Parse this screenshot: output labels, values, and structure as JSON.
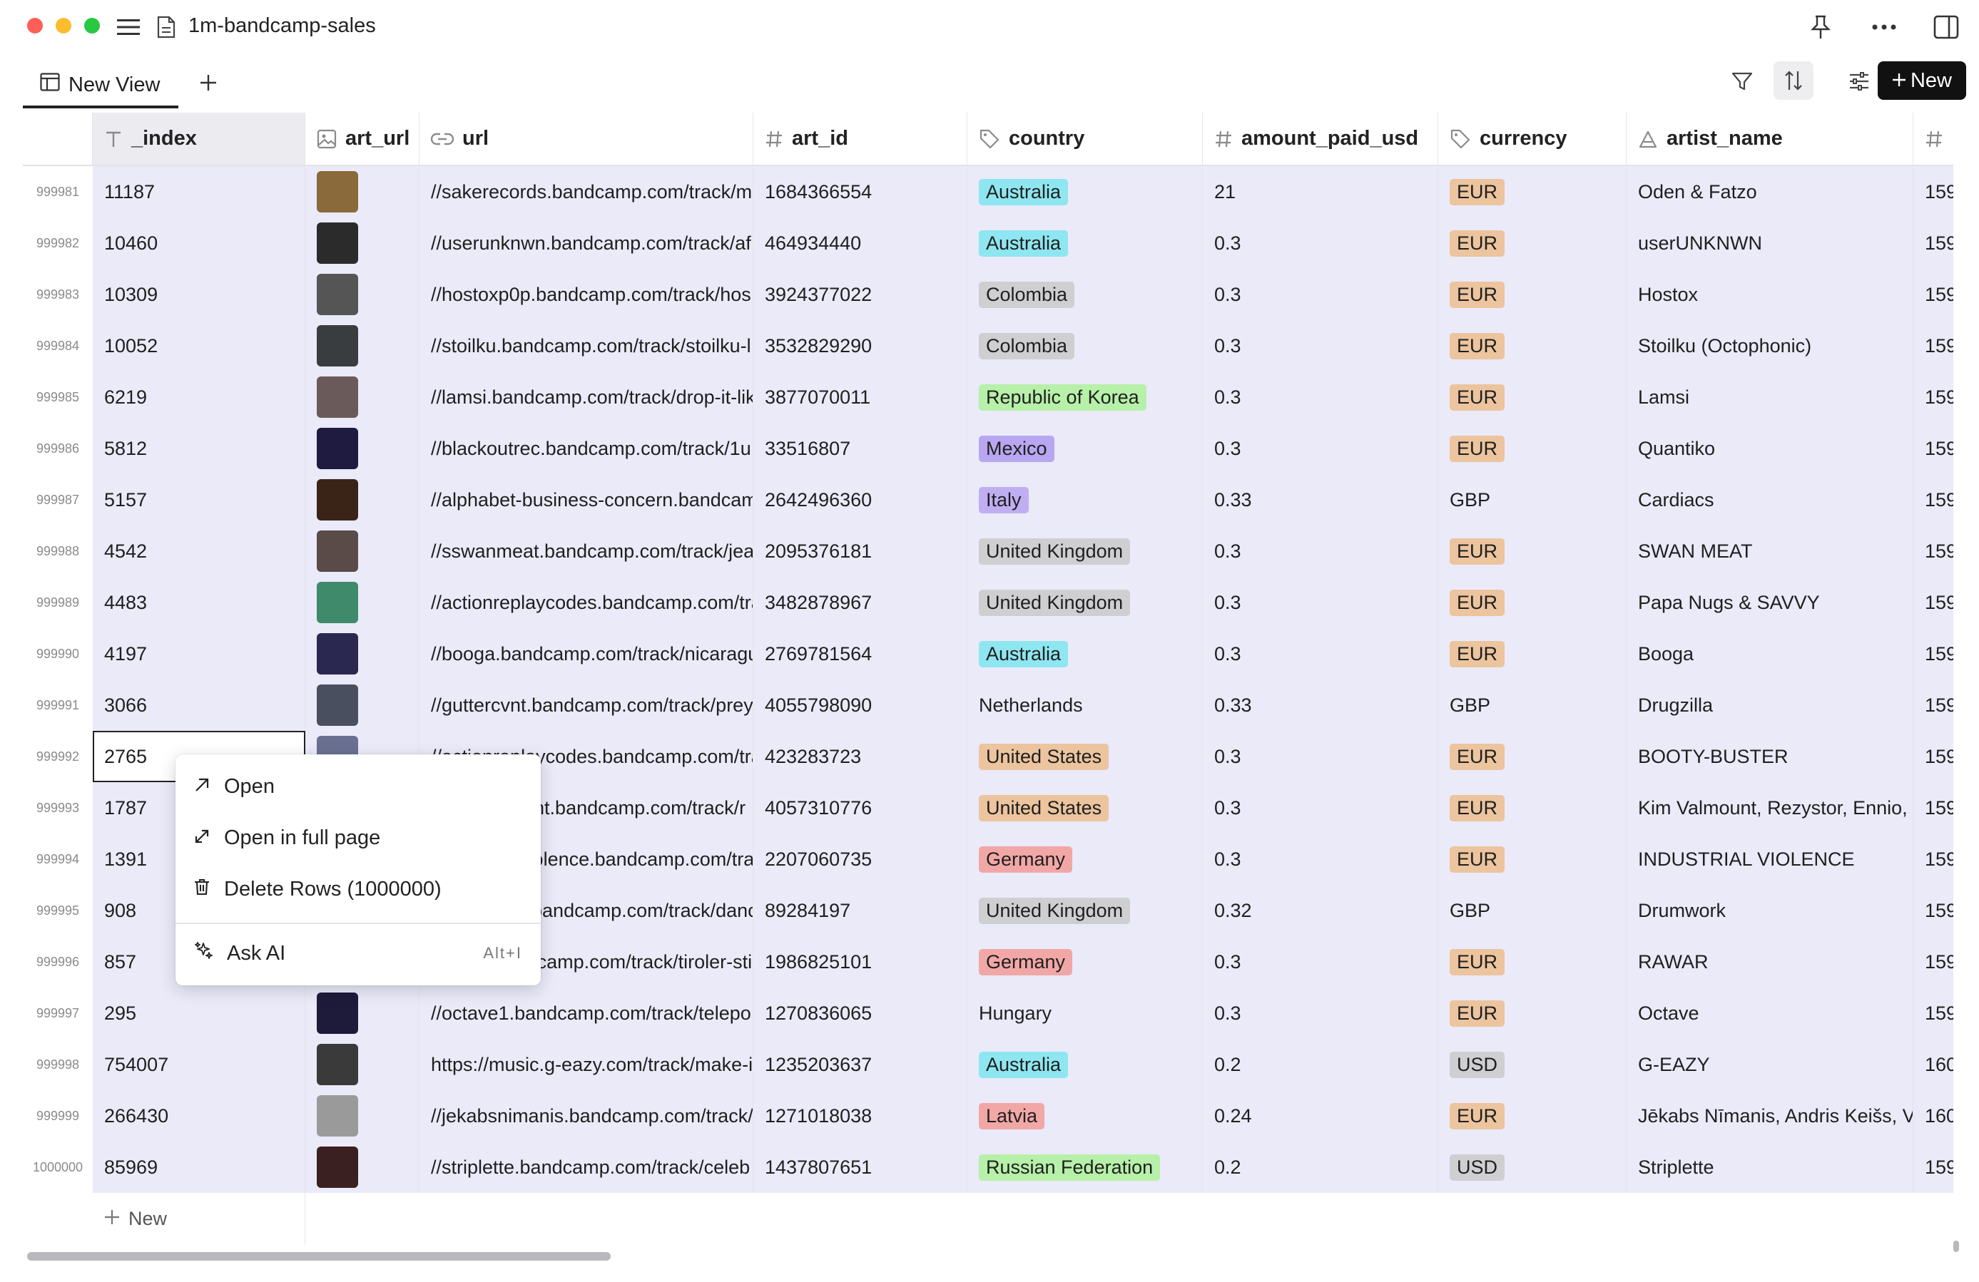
{
  "window": {
    "title": "1m-bandcamp-sales"
  },
  "colors": {
    "close": "#ff5f57",
    "minimize": "#febc2e",
    "maximize": "#28c840",
    "row_shade": "#eaeaf9"
  },
  "view": {
    "tab_label": "New View",
    "new_button": "New"
  },
  "columns": [
    {
      "name": "_index",
      "icon": "text-icon"
    },
    {
      "name": "art_url",
      "icon": "image-icon"
    },
    {
      "name": "url",
      "icon": "link-icon"
    },
    {
      "name": "art_id",
      "icon": "hash-icon"
    },
    {
      "name": "country",
      "icon": "tag-icon"
    },
    {
      "name": "amount_paid_usd",
      "icon": "hash-icon"
    },
    {
      "name": "currency",
      "icon": "tag-icon"
    },
    {
      "name": "artist_name",
      "icon": "person-icon"
    },
    {
      "name": "",
      "icon": "hash-icon"
    }
  ],
  "rows": [
    {
      "n": "999981",
      "index": "11187",
      "url": "//sakerecords.bandcamp.com/track/m",
      "art_id": "1684366554",
      "country": "Australia",
      "amount": "21",
      "currency": "EUR",
      "artist": "Oden & Fatzo",
      "last": "159"
    },
    {
      "n": "999982",
      "index": "10460",
      "url": "//userunknwn.bandcamp.com/track/af",
      "art_id": "464934440",
      "country": "Australia",
      "amount": "0.3",
      "currency": "EUR",
      "artist": "userUNKNWN",
      "last": "159"
    },
    {
      "n": "999983",
      "index": "10309",
      "url": "//hostoxp0p.bandcamp.com/track/hos",
      "art_id": "3924377022",
      "country": "Colombia",
      "amount": "0.3",
      "currency": "EUR",
      "artist": "Hostox",
      "last": "159"
    },
    {
      "n": "999984",
      "index": "10052",
      "url": "//stoilku.bandcamp.com/track/stoilku-l",
      "art_id": "3532829290",
      "country": "Colombia",
      "amount": "0.3",
      "currency": "EUR",
      "artist": "Stoilku (Octophonic)",
      "last": "159"
    },
    {
      "n": "999985",
      "index": "6219",
      "url": "//lamsi.bandcamp.com/track/drop-it-lik",
      "art_id": "3877070011",
      "country": "Republic of Korea",
      "amount": "0.3",
      "currency": "EUR",
      "artist": "Lamsi",
      "last": "159"
    },
    {
      "n": "999986",
      "index": "5812",
      "url": "//blackoutrec.bandcamp.com/track/1u",
      "art_id": "33516807",
      "country": "Mexico",
      "amount": "0.3",
      "currency": "EUR",
      "artist": "Quantiko",
      "last": "159"
    },
    {
      "n": "999987",
      "index": "5157",
      "url": "//alphabet-business-concern.bandcam|",
      "art_id": "2642496360",
      "country": "Italy",
      "amount": "0.33",
      "currency": "GBP",
      "artist": "Cardiacs",
      "last": "159"
    },
    {
      "n": "999988",
      "index": "4542",
      "url": "//sswanmeat.bandcamp.com/track/jea",
      "art_id": "2095376181",
      "country": "United Kingdom",
      "amount": "0.3",
      "currency": "EUR",
      "artist": "SWAN MEAT",
      "last": "159"
    },
    {
      "n": "999989",
      "index": "4483",
      "url": "//actionreplaycodes.bandcamp.com/tra",
      "art_id": "3482878967",
      "country": "United Kingdom",
      "amount": "0.3",
      "currency": "EUR",
      "artist": "Papa Nugs & SAVVY",
      "last": "159"
    },
    {
      "n": "999990",
      "index": "4197",
      "url": "//booga.bandcamp.com/track/nicaragu",
      "art_id": "2769781564",
      "country": "Australia",
      "amount": "0.3",
      "currency": "EUR",
      "artist": "Booga",
      "last": "159"
    },
    {
      "n": "999991",
      "index": "3066",
      "url": "//guttercvnt.bandcamp.com/track/prey",
      "art_id": "4055798090",
      "country": "Netherlands",
      "amount": "0.33",
      "currency": "GBP",
      "artist": "Drugzilla",
      "last": "159"
    },
    {
      "n": "999992",
      "index": "2765",
      "url": "//actionreplaycodes.bandcamp.com/tra",
      "art_id": "423283723",
      "country": "United States",
      "amount": "0.3",
      "currency": "EUR",
      "artist": "BOOTY-BUSTER",
      "last": "159"
    },
    {
      "n": "999993",
      "index": "1787",
      "url": "//kimvalmount.bandcamp.com/track/r",
      "art_id": "4057310776",
      "country": "United States",
      "amount": "0.3",
      "currency": "EUR",
      "artist": "Kim Valmount, Rezystor, Ennio, Da",
      "last": "159"
    },
    {
      "n": "999994",
      "index": "1391",
      "url": "//industrialviolence.bandcamp.com/tra",
      "art_id": "2207060735",
      "country": "Germany",
      "amount": "0.3",
      "currency": "EUR",
      "artist": "INDUSTRIAL VIOLENCE",
      "last": "159"
    },
    {
      "n": "999995",
      "index": "908",
      "url": "//drumwork.bandcamp.com/track/danc",
      "art_id": "89284197",
      "country": "United Kingdom",
      "amount": "0.32",
      "currency": "GBP",
      "artist": "Drumwork",
      "last": "159"
    },
    {
      "n": "999996",
      "index": "857",
      "url": "//rawar.bandcamp.com/track/tiroler-sti",
      "art_id": "1986825101",
      "country": "Germany",
      "amount": "0.3",
      "currency": "EUR",
      "artist": "RAWAR",
      "last": "159"
    },
    {
      "n": "999997",
      "index": "295",
      "url": "//octave1.bandcamp.com/track/telepo",
      "art_id": "1270836065",
      "country": "Hungary",
      "amount": "0.3",
      "currency": "EUR",
      "artist": "Octave",
      "last": "159"
    },
    {
      "n": "999998",
      "index": "754007",
      "url": "https://music.g-eazy.com/track/make-i",
      "art_id": "1235203637",
      "country": "Australia",
      "amount": "0.2",
      "currency": "USD",
      "artist": "G-EAZY",
      "last": "160"
    },
    {
      "n": "999999",
      "index": "266430",
      "url": "//jekabsnimanis.bandcamp.com/track/",
      "art_id": "1271018038",
      "country": "Latvia",
      "amount": "0.24",
      "currency": "EUR",
      "artist": "Jēkabs Nīmanis, Andris Keišs, Vil",
      "last": "160"
    },
    {
      "n": "1000000",
      "index": "85969",
      "url": "//striplette.bandcamp.com/track/celeb",
      "art_id": "1437807651",
      "country": "Russian Federation",
      "amount": "0.2",
      "currency": "USD",
      "artist": "Striplette",
      "last": "159"
    }
  ],
  "tag_colors": {
    "Australia": "#8ee6f0",
    "Colombia": "#cfcfd2",
    "Republic of Korea": "#b7f0a8",
    "Mexico": "#b9a6f0",
    "Italy": "#c0aef2",
    "United Kingdom": "#cfcfd2",
    "Netherlands": "transparent",
    "United States": "#ecc49e",
    "Germany": "#f2a7a7",
    "Hungary": "transparent",
    "Latvia": "#f2a7a7",
    "Russian Federation": "#b7f0a8",
    "EUR": "#ecc49e",
    "GBP": "transparent",
    "USD": "#cfcfd2"
  },
  "add_row_label": "New",
  "context_menu": {
    "open": "Open",
    "open_full": "Open in full page",
    "delete": "Delete Rows (1000000)",
    "ask_ai": "Ask AI",
    "ask_ai_shortcut": "Alt+I"
  }
}
